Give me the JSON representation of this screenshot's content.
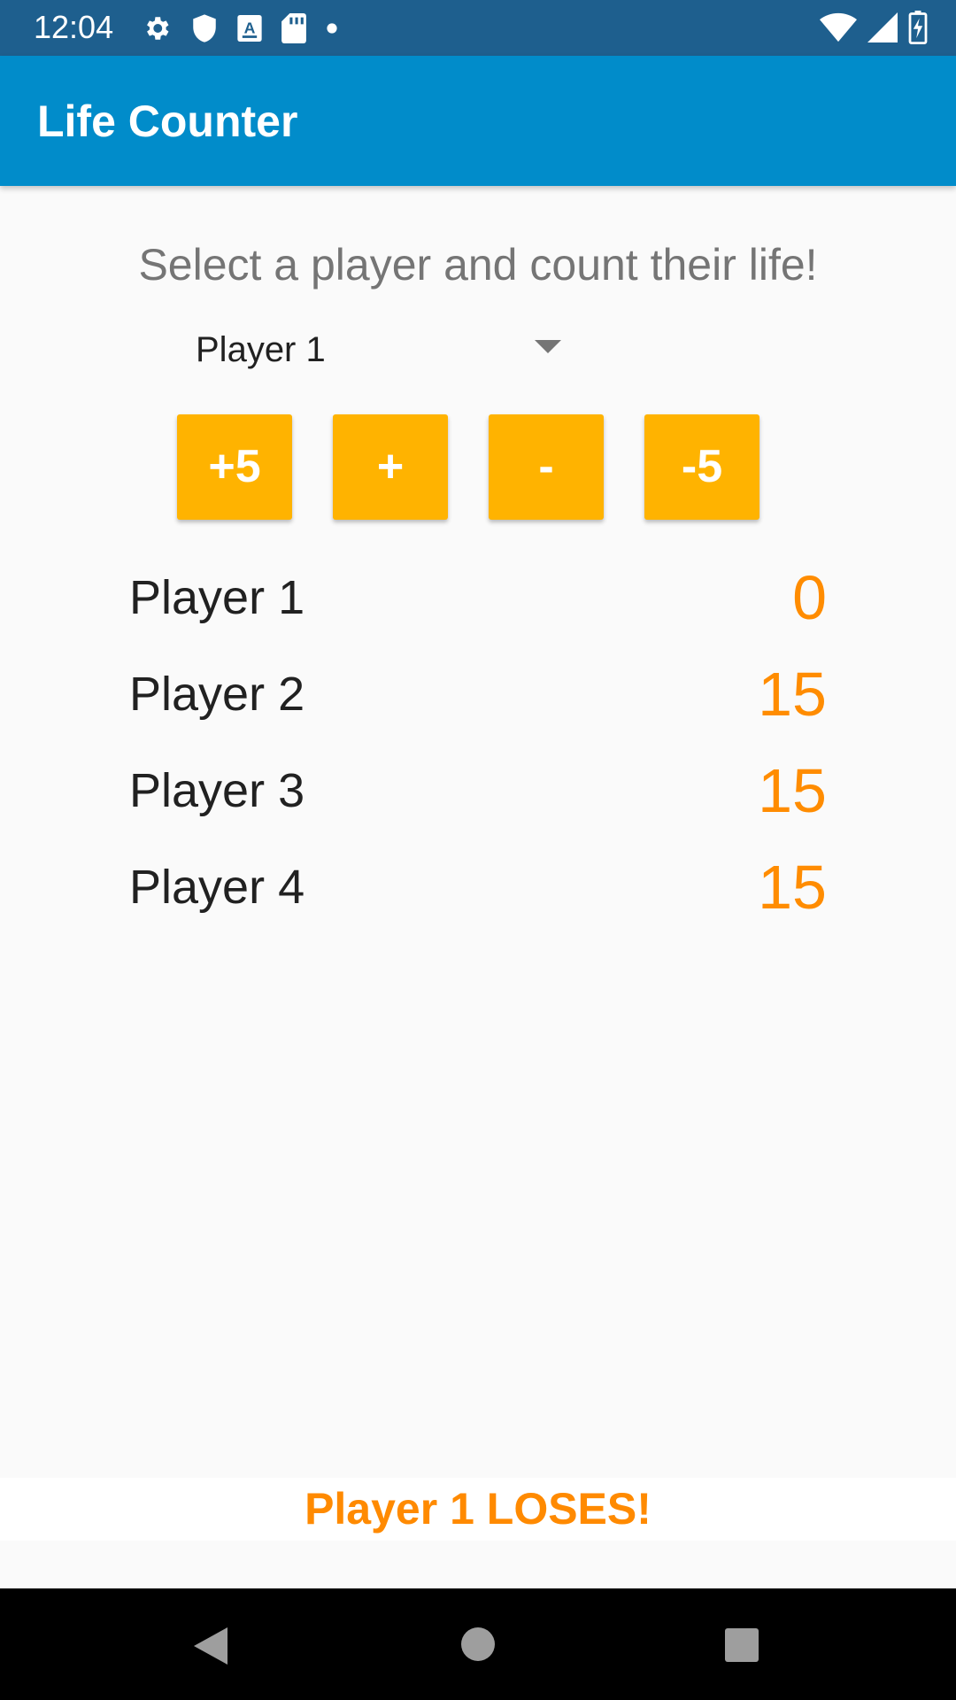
{
  "status_bar": {
    "time": "12:04",
    "left_icons": [
      "gear-icon",
      "shield-icon",
      "a-badge-icon",
      "sd-card-icon",
      "dot-icon"
    ],
    "right_icons": [
      "wifi-icon",
      "cell-signal-icon",
      "battery-icon"
    ]
  },
  "app_bar": {
    "title": "Life Counter",
    "color": "#018cca"
  },
  "main": {
    "instruction": "Select a player and count their life!",
    "player_select": {
      "selected": "Player 1"
    },
    "buttons": {
      "plus5": "+5",
      "plus1": "+",
      "minus1": "-",
      "minus5": "-5"
    },
    "button_color": "#ffb300",
    "players": [
      {
        "name": "Player 1",
        "life": "0"
      },
      {
        "name": "Player 2",
        "life": "15"
      },
      {
        "name": "Player 3",
        "life": "15"
      },
      {
        "name": "Player 4",
        "life": "15"
      }
    ],
    "life_color": "#ff8c00",
    "result": "Player 1 LOSES!"
  },
  "nav_bar": {
    "icons": [
      "back-icon",
      "home-icon",
      "recents-icon"
    ]
  }
}
